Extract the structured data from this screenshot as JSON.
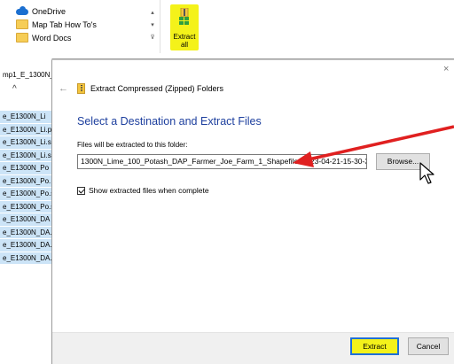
{
  "explorer": {
    "nav_items": [
      {
        "label": "OneDrive",
        "icon": "onedrive-cloud-icon"
      },
      {
        "label": "Map Tab How To's",
        "icon": "folder-icon"
      },
      {
        "label": "Word Docs",
        "icon": "folder-icon"
      }
    ],
    "scroll_up": "▴",
    "scroll_down": "▾",
    "scroll_more": "⊽",
    "extract_all_label": "Extract all",
    "address_fragment": "mp1_E_1300N_",
    "up_caret": "^",
    "files": [
      "e_E1300N_Li",
      "e_E1300N_Li.p",
      "e_E1300N_Li.sl",
      "e_E1300N_Li.sl",
      "e_E1300N_Po",
      "e_E1300N_Po.",
      "e_E1300N_Po.s",
      "e_E1300N_Po.s",
      "e_E1300N_DA",
      "e_E1300N_DA.",
      "e_E1300N_DA.",
      "e_E1300N_DA."
    ],
    "close_glyph": "×"
  },
  "dialog": {
    "back_glyph": "←",
    "title": "Extract Compressed (Zipped) Folders",
    "heading": "Select a Destination and Extract Files",
    "field_label": "Files will be extracted to this folder:",
    "path_value": "1300N_Lime_100_Potash_DAP_Farmer_Joe_Farm_1_Shapefiles2023-04-21-15-30-38",
    "browse_label": "Browse...",
    "show_files_label": "Show extracted files when complete",
    "show_files_checked": true,
    "extract_label": "Extract",
    "cancel_label": "Cancel"
  },
  "colors": {
    "highlight": "#f4f21a",
    "heading_blue": "#1d3f9e",
    "selection": "#cce4f7",
    "annotation_arrow": "#e02020"
  }
}
